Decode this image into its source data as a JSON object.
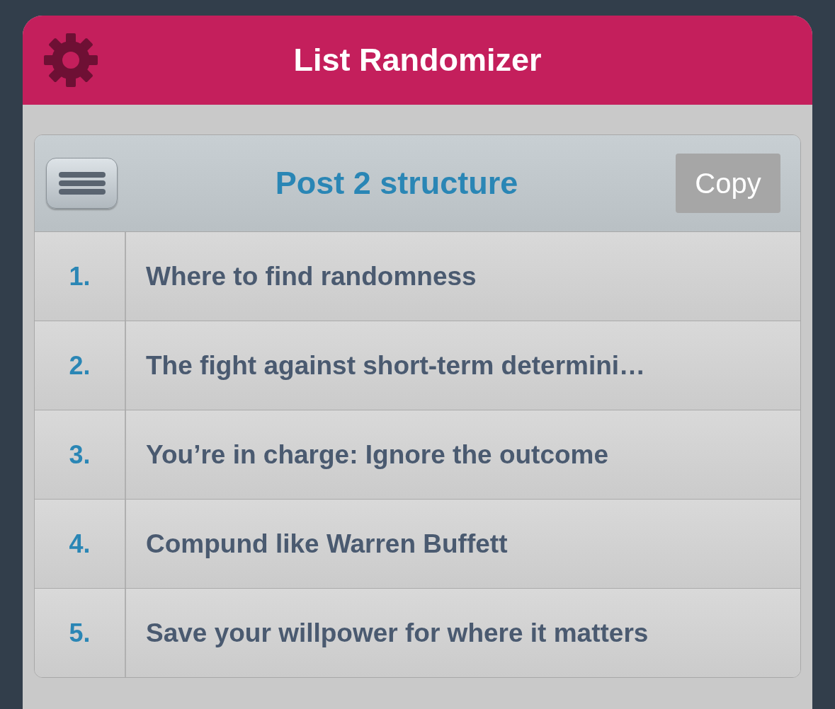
{
  "app_bar": {
    "title": "List Randomizer"
  },
  "list": {
    "title": "Post 2 structure",
    "copy_button": "Copy",
    "items": [
      {
        "number": "1.",
        "text": "Where to find randomness"
      },
      {
        "number": "2.",
        "text": "The fight against short-term determini…"
      },
      {
        "number": "3.",
        "text": "You’re in charge: Ignore the outcome"
      },
      {
        "number": "4.",
        "text": "Compund like Warren Buffett"
      },
      {
        "number": "5.",
        "text": "Save your willpower for where it matters"
      }
    ]
  }
}
